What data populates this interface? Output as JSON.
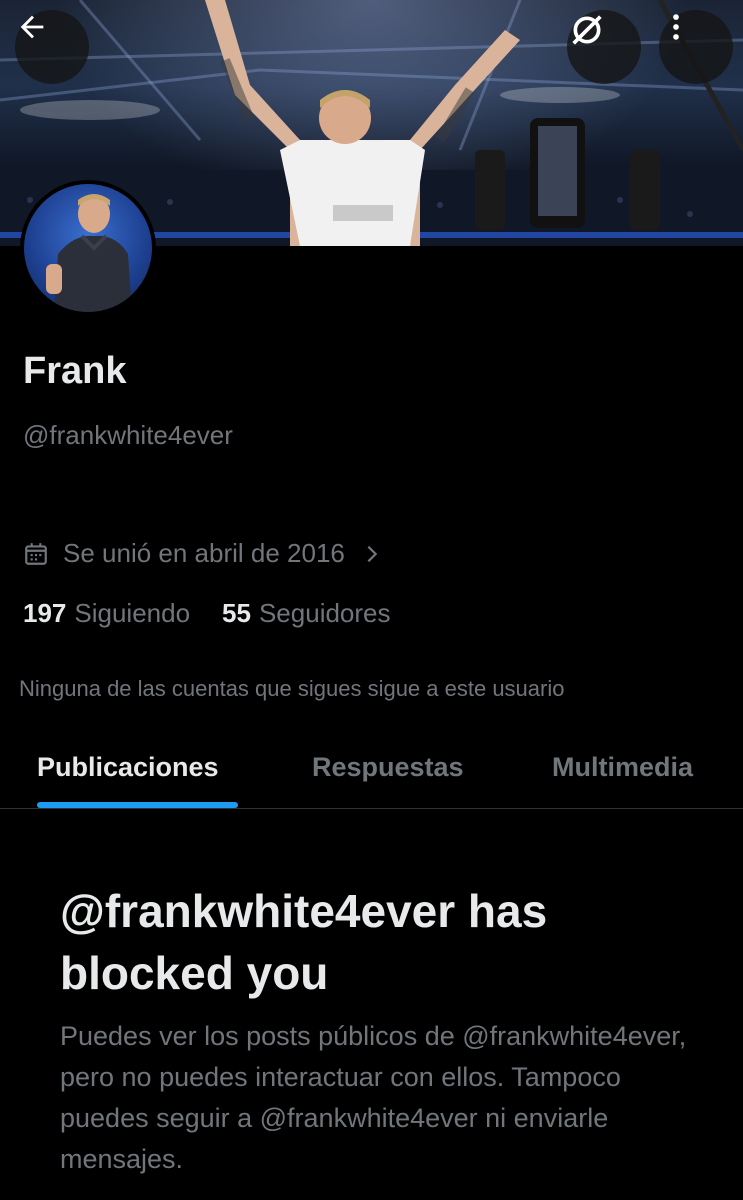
{
  "header": {
    "back_icon": "arrow-left-icon",
    "grok_icon": "slash-circle-icon",
    "more_icon": "vertical-dots-icon"
  },
  "profile": {
    "name": "Frank",
    "handle": "@frankwhite4ever",
    "joined": "Se unió en abril de 2016",
    "following_count": "197",
    "following_label": "Siguiendo",
    "followers_count": "55",
    "followers_label": "Seguidores",
    "followers_note": "Ninguna de las cuentas que sigues sigue a este usuario"
  },
  "tabs": [
    {
      "label": "Publicaciones",
      "active": true
    },
    {
      "label": "Respuestas",
      "active": false
    },
    {
      "label": "Multimedia",
      "active": false
    }
  ],
  "blocked": {
    "title": "@frankwhite4ever has blocked you",
    "description": "Puedes ver los posts públicos de @frankwhite4ever, pero no puedes interactuar con ellos. Tampoco puedes seguir a @frankwhite4ever ni enviarle mensajes."
  },
  "colors": {
    "background": "#000000",
    "text_primary": "#e7e9ea",
    "text_secondary": "#71767b",
    "accent": "#1d9bf0",
    "divider": "#2f3336"
  }
}
